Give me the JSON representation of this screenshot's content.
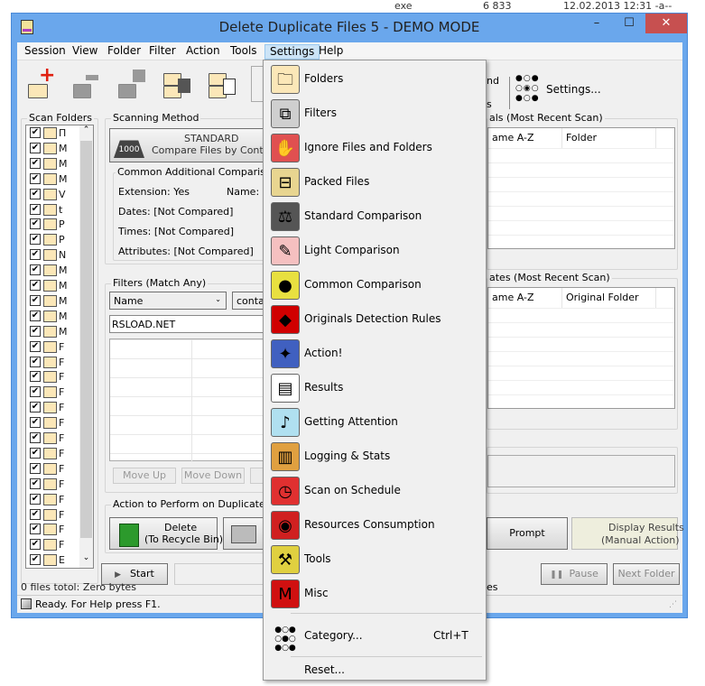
{
  "background": {
    "cols": [
      "exe",
      "6 833",
      "12.02.2013 12:31 -a--"
    ]
  },
  "window": {
    "title": "Delete Duplicate Files 5 - DEMO MODE",
    "minimize": "–",
    "maximize": "☐",
    "close": "✕"
  },
  "menubar": [
    "Session",
    "View",
    "Folder",
    "Filter",
    "Action",
    "Tools",
    "Settings",
    "Help"
  ],
  "toolbar": {
    "settings_label": "Settings...",
    "partial1": "nd",
    "partial2": "s"
  },
  "scan_folders": {
    "label": "Scan Folders",
    "items": [
      "П",
      "M",
      "M",
      "M",
      "V",
      "t",
      "P",
      "P",
      "N",
      "M",
      "M",
      "M",
      "M",
      "M",
      "F",
      "F",
      "F",
      "F",
      "F",
      "F",
      "F",
      "F",
      "F",
      "F",
      "F",
      "F",
      "F",
      "F",
      "E"
    ]
  },
  "scanning": {
    "label": "Scanning Method",
    "method_title": "STANDARD",
    "method_sub": "Compare Files by Content",
    "criteria_label": "Common Additional Comparison Cri",
    "extension": "Extension: Yes",
    "name": "Name: No",
    "dates": "Dates:  [Not Compared]",
    "times": "Times:  [Not Compared]",
    "attributes": "Attributes:  [Not Compared]"
  },
  "filters": {
    "label": "Filters (Match Any)",
    "field": "Name",
    "op": "contain",
    "value": "RSLOAD.NET",
    "move_up": "Move Up",
    "move_down": "Move Down"
  },
  "originals": {
    "label": "als (Most Recent Scan)",
    "col1": "ame A-Z",
    "col2": "Folder"
  },
  "duplicates": {
    "label": "ates (Most Recent Scan)",
    "col1": "ame A-Z",
    "col2": "Original Folder"
  },
  "action": {
    "label": "Action to Perform on Duplicates",
    "delete_l1": "Delete",
    "delete_l2": "(To Recycle Bin)",
    "prompt": "Prompt",
    "display_l1": "Display Results",
    "display_l2": "(Manual Action)"
  },
  "controls": {
    "start": "Start",
    "pause": "Pause",
    "next": "Next Folder"
  },
  "status": {
    "files": "0 files totol: Zero bytes",
    "files_right": "es",
    "ready": "Ready. For Help press F1."
  },
  "settings_menu": {
    "items": [
      {
        "label": "Folders",
        "icon": "folders-icon",
        "glyph": "🗀",
        "color": "#fbe7b8"
      },
      {
        "label": "Filters",
        "icon": "filters-icon",
        "glyph": "⧉",
        "color": "#cfcfcf"
      },
      {
        "label": "Ignore Files and Folders",
        "icon": "ignore-icon",
        "glyph": "✋",
        "color": "#e05050"
      },
      {
        "label": "Packed Files",
        "icon": "packed-files-icon",
        "glyph": "⊟",
        "color": "#e8d590"
      },
      {
        "label": "Standard Comparison",
        "icon": "weight-icon",
        "glyph": "⚖",
        "color": "#555555"
      },
      {
        "label": "Light Comparison",
        "icon": "feather-icon",
        "glyph": "✎",
        "color": "#f5c0c0"
      },
      {
        "label": "Common Comparison",
        "icon": "lemon-icon",
        "glyph": "●",
        "color": "#e8e040"
      },
      {
        "label": "Originals Detection Rules",
        "icon": "detective-icon",
        "glyph": "◆",
        "color": "#d00000"
      },
      {
        "label": "Action!",
        "icon": "clapper-icon",
        "glyph": "✦",
        "color": "#4060c0"
      },
      {
        "label": "Results",
        "icon": "results-icon",
        "glyph": "▤",
        "color": "#ffffff"
      },
      {
        "label": "Getting Attention",
        "icon": "attention-icon",
        "glyph": "♪",
        "color": "#b0e0f0"
      },
      {
        "label": "Logging & Stats",
        "icon": "stats-icon",
        "glyph": "▥",
        "color": "#e0a040"
      },
      {
        "label": "Scan on Schedule",
        "icon": "clock-icon",
        "glyph": "◷",
        "color": "#e03030"
      },
      {
        "label": "Resources Consumption",
        "icon": "car-icon",
        "glyph": "◉",
        "color": "#d02020"
      },
      {
        "label": "Tools",
        "icon": "tools-icon",
        "glyph": "⚒",
        "color": "#e0d040"
      },
      {
        "label": "Misc",
        "icon": "misc-icon",
        "glyph": "M",
        "color": "#d01010"
      }
    ],
    "category": "Category...",
    "category_shortcut": "Ctrl+T",
    "reset": "Reset..."
  }
}
